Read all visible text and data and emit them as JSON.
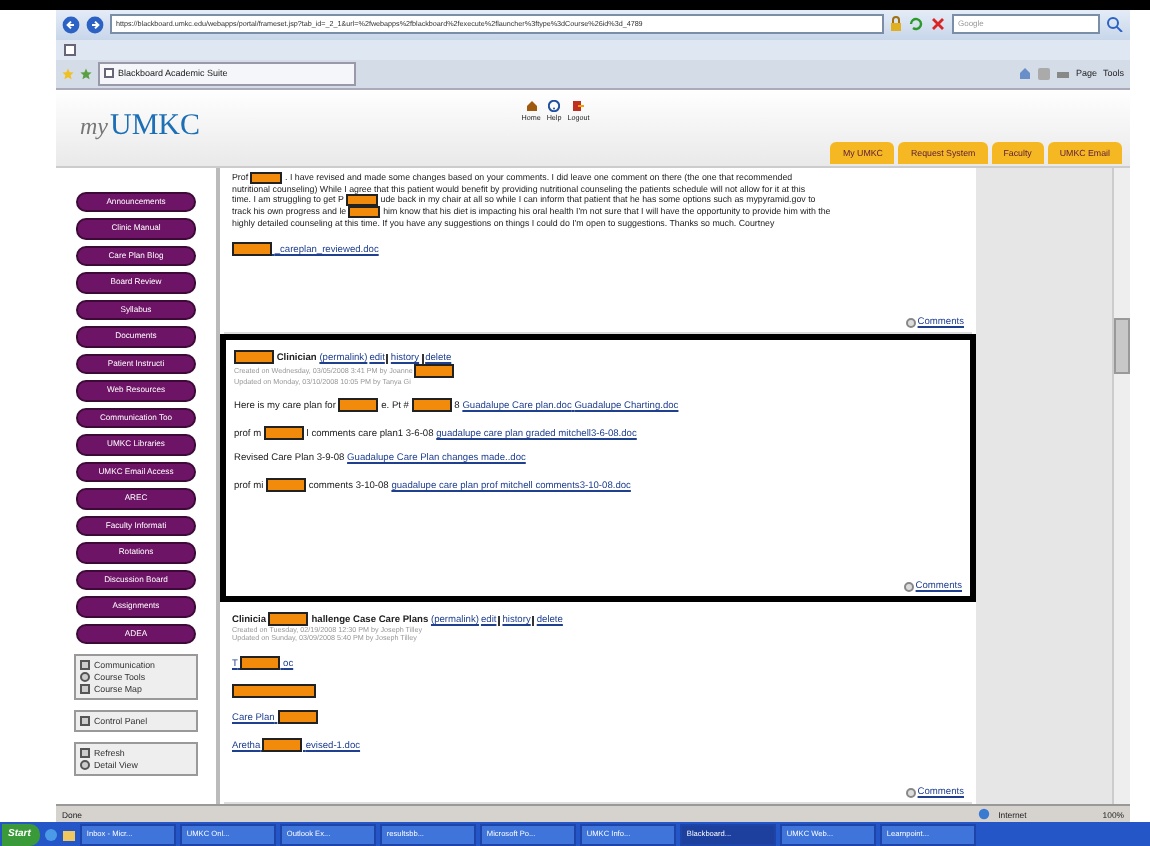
{
  "browser": {
    "url": "https://blackboard.umkc.edu/webapps/portal/frameset.jsp?tab_id=_2_1&url=%2fwebapps%2fblackboard%2fexecute%2flauncher%3ftype%3dCourse%26id%3d_4789",
    "search_placeholder": "Google",
    "tab": "Blackboard Academic Suite",
    "toolbar": [
      "Page",
      "Tools"
    ]
  },
  "header": {
    "logo_prefix": "my",
    "logo": "UMKC",
    "links": [
      "Home",
      "Help",
      "Logout"
    ],
    "tabs": [
      "My UMKC",
      "Request System",
      "Faculty",
      "UMKC Email"
    ]
  },
  "nav": [
    "Announcements",
    "Clinic Manual",
    "Care Plan Blog",
    "Board Review",
    "Syllabus",
    "Documents",
    "Patient Instructi",
    "Web Resources",
    "Communication Too",
    "UMKC Libraries",
    "UMKC Email Access",
    "AREC",
    "Faculty Informati",
    "Rotations",
    "Discussion Board",
    "Assignments",
    "ADEA"
  ],
  "tool_groups": [
    [
      "Communication",
      "Course Tools",
      "Course Map"
    ],
    [
      "Control Panel"
    ],
    [
      "Refresh",
      "Detail View"
    ]
  ],
  "posts": [
    {
      "highlighted": false,
      "paragraph": [
        [
          {
            "kind": "text",
            "text": "Prof"
          },
          {
            "kind": "redaction"
          },
          {
            "kind": "text",
            "text": ". I have revised and made some changes based on your comments. I did leave one comment on there (the one that recommended"
          }
        ],
        [
          {
            "kind": "text",
            "text": "nutritional counseling) While I agree that this patient would benefit by providing nutritional counseling the patients schedule will not allow for it at this"
          }
        ],
        [
          {
            "kind": "text",
            "text": "time. I am struggling to get P"
          },
          {
            "kind": "redaction"
          },
          {
            "kind": "text",
            "text": "ude back in my chair at all so while I can inform that patient that he has some options such as mypyramid.gov to"
          }
        ],
        [
          {
            "kind": "text",
            "text": "track his own progress and le"
          },
          {
            "kind": "redaction"
          },
          {
            "kind": "text",
            "text": "him know that his diet is impacting his oral health I'm not sure that I will have the opportunity to provide him with the"
          }
        ],
        [
          {
            "kind": "text",
            "text": "highly detailed counseling at this time. If you have any suggestions on things I could do I'm open to suggestions. Thanks so much. Courtney"
          }
        ]
      ],
      "lines": [
        [
          {
            "kind": "link",
            "parts": [
              {
                "kind": "redaction"
              },
              {
                "kind": "text",
                "text": "_careplan_reviewed.doc"
              }
            ]
          }
        ]
      ],
      "comments": "Comments"
    },
    {
      "highlighted": true,
      "title": [
        {
          "kind": "redaction"
        },
        {
          "kind": "text",
          "text": "Clinician"
        }
      ],
      "actions": [
        "(permalink)",
        "edit",
        "history",
        "delete"
      ],
      "meta": [
        [
          {
            "kind": "text",
            "text": "Created on Wednesday, 03/05/2008 3:41 PM by Joanne"
          },
          {
            "kind": "redaction"
          }
        ],
        [
          {
            "kind": "text",
            "text": "Updated on Monday, 03/10/2008 10:05 PM by Tanya Gi"
          }
        ]
      ],
      "lines": [
        [
          {
            "kind": "text",
            "text": "Here is my care plan for"
          },
          {
            "kind": "redaction"
          },
          {
            "kind": "text",
            "text": "e. Pt #"
          },
          {
            "kind": "redaction"
          },
          {
            "kind": "text",
            "text": "8"
          },
          {
            "kind": "link",
            "parts": [
              {
                "kind": "text",
                "text": "Guadalupe Care plan.doc"
              }
            ]
          },
          {
            "kind": "link",
            "parts": [
              {
                "kind": "text",
                "text": "Guadalupe Charting.doc"
              }
            ]
          }
        ],
        [
          {
            "kind": "text",
            "text": "prof m"
          },
          {
            "kind": "redaction"
          },
          {
            "kind": "text",
            "text": "l comments care plan1 3-6-08"
          },
          {
            "kind": "link",
            "parts": [
              {
                "kind": "text",
                "text": "guadalupe care plan graded mitchell3-6-08.doc"
              }
            ]
          }
        ],
        [
          {
            "kind": "text",
            "text": "Revised Care Plan 3-9-08"
          },
          {
            "kind": "link",
            "parts": [
              {
                "kind": "text",
                "text": "Guadalupe Care Plan changes made..doc"
              }
            ]
          }
        ],
        [
          {
            "kind": "text",
            "text": "prof mi"
          },
          {
            "kind": "redaction"
          },
          {
            "kind": "text",
            "text": "comments 3-10-08"
          },
          {
            "kind": "link",
            "parts": [
              {
                "kind": "text",
                "text": "guadalupe care plan prof mitchell comments3-10-08.doc"
              }
            ]
          }
        ]
      ],
      "comments": "Comments"
    },
    {
      "highlighted": false,
      "title": [
        {
          "kind": "text",
          "text": "Clinicia"
        },
        {
          "kind": "redaction"
        },
        {
          "kind": "text",
          "text": "hallenge Case Care Plans"
        }
      ],
      "actions": [
        "(permalink)",
        "edit",
        "history",
        "delete"
      ],
      "meta": [
        [
          {
            "kind": "text",
            "text": "Created on Tuesday, 02/19/2008 12:30 PM by Joseph Tilley"
          }
        ],
        [
          {
            "kind": "text",
            "text": "Updated on Sunday, 03/09/2008 5:40 PM by Joseph Tilley"
          }
        ]
      ],
      "lines": [
        [
          {
            "kind": "link",
            "parts": [
              {
                "kind": "text",
                "text": "T"
              },
              {
                "kind": "redaction"
              },
              {
                "kind": "text",
                "text": "oc"
              }
            ]
          }
        ],
        [
          {
            "kind": "redaction"
          }
        ],
        [
          {
            "kind": "link",
            "parts": [
              {
                "kind": "text",
                "text": "Care Plan"
              },
              {
                "kind": "redaction"
              }
            ]
          }
        ],
        [
          {
            "kind": "link",
            "parts": [
              {
                "kind": "text",
                "text": "Aretha"
              },
              {
                "kind": "redaction"
              },
              {
                "kind": "text",
                "text": "evised-1.doc"
              }
            ]
          }
        ]
      ],
      "comments": "Comments"
    }
  ],
  "status": {
    "text": "Done",
    "zone": "Internet",
    "zoom": "100%"
  },
  "taskbar": {
    "start": "Start",
    "items": [
      {
        "label": "Inbox - Micr...",
        "selected": false
      },
      {
        "label": "UMKC Onl...",
        "selected": false
      },
      {
        "label": "Outlook Ex...",
        "selected": false
      },
      {
        "label": "resultsbb...",
        "selected": false
      },
      {
        "label": "Microsoft Po...",
        "selected": false
      },
      {
        "label": "UMKC Info...",
        "selected": false
      },
      {
        "label": "Blackboard...",
        "selected": true
      },
      {
        "label": "UMKC Web...",
        "selected": false
      },
      {
        "label": "Learnpoint...",
        "selected": false
      }
    ]
  }
}
